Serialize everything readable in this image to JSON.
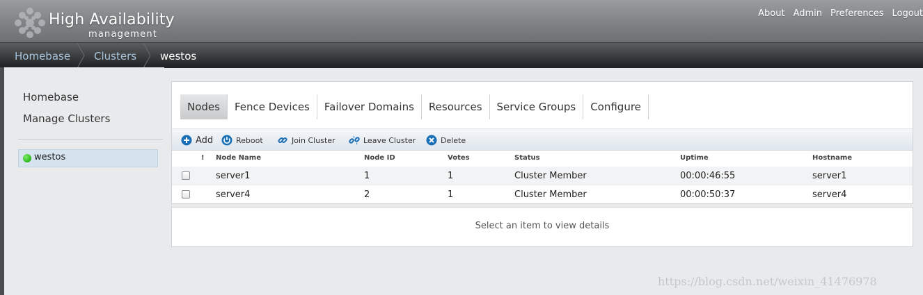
{
  "header": {
    "title": "High Availability",
    "subtitle": "management",
    "nav": [
      "About",
      "Admin",
      "Preferences",
      "Logout"
    ]
  },
  "breadcrumb": [
    "Homebase",
    "Clusters",
    "westos"
  ],
  "sidebar": {
    "links": [
      "Homebase",
      "Manage Clusters"
    ],
    "clusters": [
      {
        "name": "westos",
        "status": "online"
      }
    ]
  },
  "tabs": [
    "Nodes",
    "Fence Devices",
    "Failover Domains",
    "Resources",
    "Service Groups",
    "Configure"
  ],
  "active_tab": "Nodes",
  "toolbar": {
    "add": "Add",
    "reboot": "Reboot",
    "join": "Join Cluster",
    "leave": "Leave Cluster",
    "delete": "Delete"
  },
  "table": {
    "columns": [
      "!",
      "Node Name",
      "Node ID",
      "Votes",
      "Status",
      "Uptime",
      "Hostname"
    ],
    "rows": [
      {
        "name": "server1",
        "id": "1",
        "votes": "1",
        "status": "Cluster Member",
        "uptime": "00:00:46:55",
        "hostname": "server1"
      },
      {
        "name": "server4",
        "id": "2",
        "votes": "1",
        "status": "Cluster Member",
        "uptime": "00:00:50:37",
        "hostname": "server4"
      }
    ]
  },
  "details": {
    "empty_message": "Select an item to view details"
  },
  "watermark": "https://blog.csdn.net/weixin_41476978",
  "colors": {
    "accent": "#1a6fb5",
    "status_online": "#2bb31a",
    "breadcrumb_link": "#a8c6de"
  }
}
